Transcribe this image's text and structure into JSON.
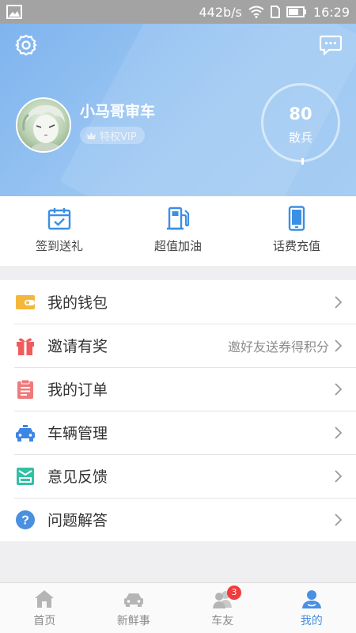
{
  "status_bar": {
    "speed": "442b/s",
    "time": "16:29"
  },
  "header": {
    "username": "小马哥审车",
    "vip_label": "特权VIP",
    "rank_value": "80",
    "rank_label": "散兵"
  },
  "quick_actions": [
    {
      "label": "签到送礼",
      "icon": "calendar-check-icon"
    },
    {
      "label": "超值加油",
      "icon": "fuel-pump-icon"
    },
    {
      "label": "话费充值",
      "icon": "phone-icon"
    }
  ],
  "menu": [
    {
      "label": "我的钱包",
      "hint": "",
      "icon": "wallet-icon"
    },
    {
      "label": "邀请有奖",
      "hint": "邀好友送券得积分",
      "icon": "gift-icon"
    },
    {
      "label": "我的订单",
      "hint": "",
      "icon": "clipboard-icon"
    },
    {
      "label": "车辆管理",
      "hint": "",
      "icon": "car-icon"
    },
    {
      "label": "意见反馈",
      "hint": "",
      "icon": "feedback-icon"
    },
    {
      "label": "问题解答",
      "hint": "",
      "icon": "question-icon"
    }
  ],
  "tabs": [
    {
      "label": "首页",
      "icon": "home-icon"
    },
    {
      "label": "新鲜事",
      "icon": "car-outline-icon"
    },
    {
      "label": "车友",
      "icon": "friends-icon",
      "badge": "3"
    },
    {
      "label": "我的",
      "icon": "profile-icon"
    }
  ],
  "colors": {
    "accent": "#4a8fe0",
    "header_gradient_start": "#7fb4ee",
    "header_gradient_end": "#a6cdf3",
    "badge": "#f23b3b"
  }
}
